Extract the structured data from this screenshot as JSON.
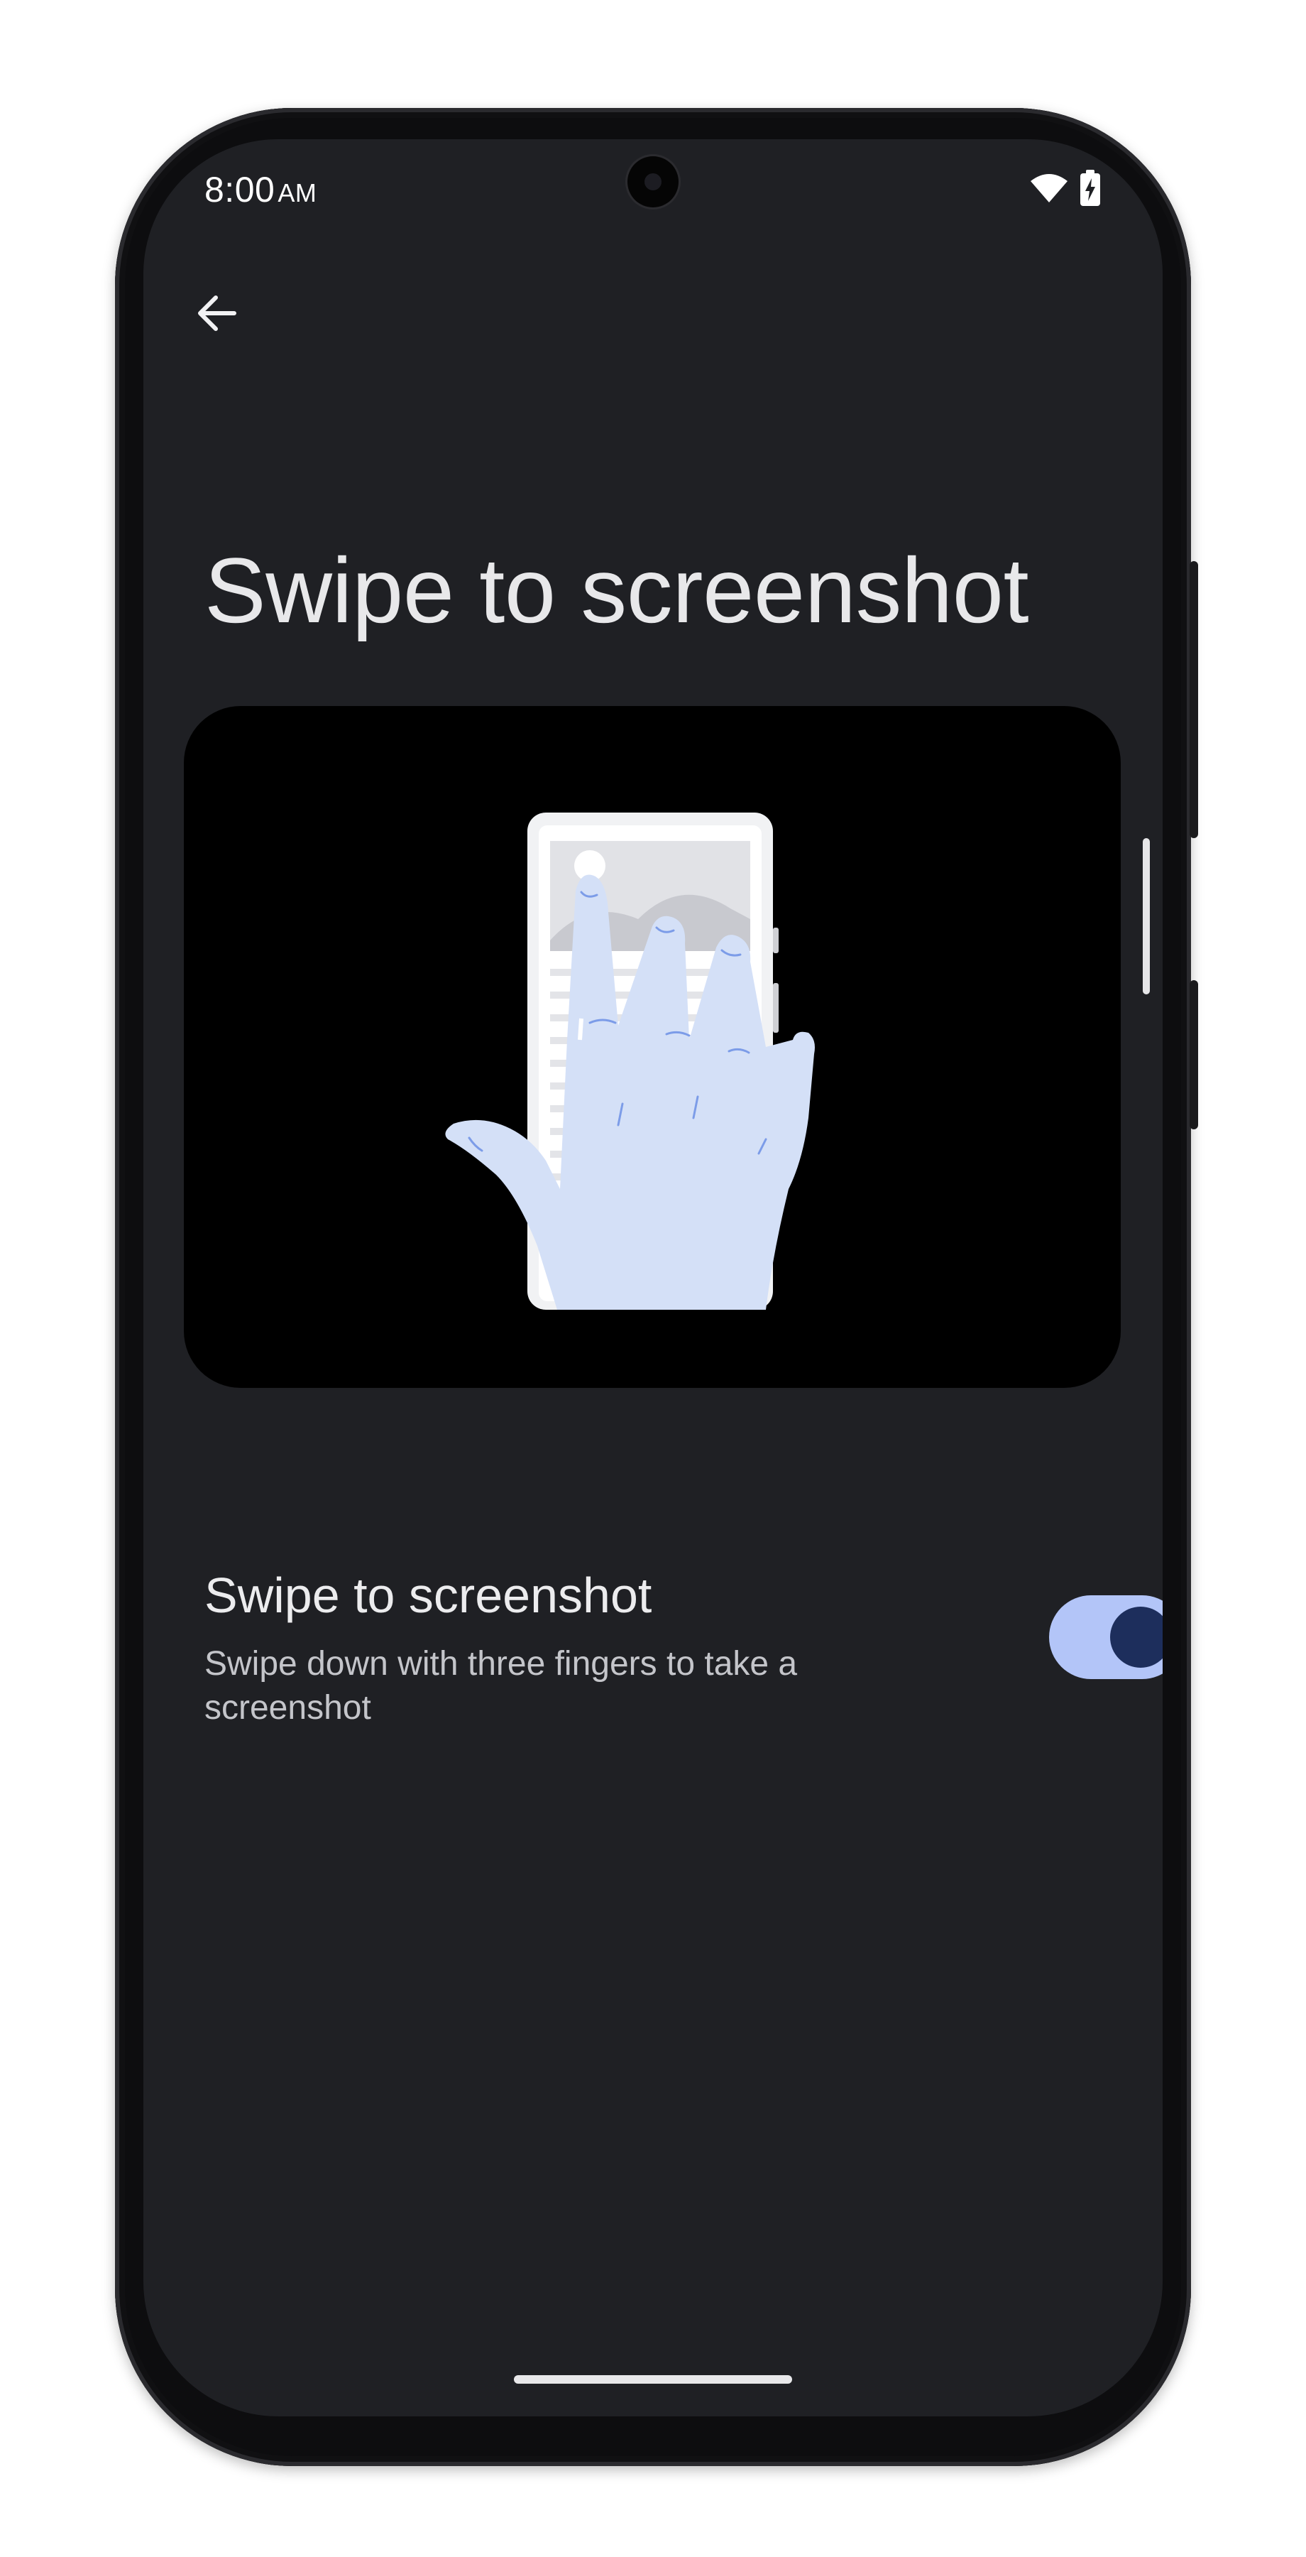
{
  "status_bar": {
    "time": "8:00",
    "ampm": "AM",
    "icons": [
      "wifi-icon",
      "battery-charging-icon"
    ]
  },
  "navigation": {
    "back_icon": "arrow-left-icon"
  },
  "page": {
    "title": "Swipe to screenshot"
  },
  "illustration": {
    "icon": "three-finger-swipe-hand-illustration"
  },
  "setting": {
    "title": "Swipe to screenshot",
    "summary": "Swipe down with three fingers to take a screenshot",
    "enabled": true
  },
  "colors": {
    "background": "#1f2024",
    "toggle_track": "#b3c5f8",
    "toggle_thumb": "#1d2e5c",
    "hand": "#d4e0f7",
    "hand_lines": "#7c9ce8"
  }
}
